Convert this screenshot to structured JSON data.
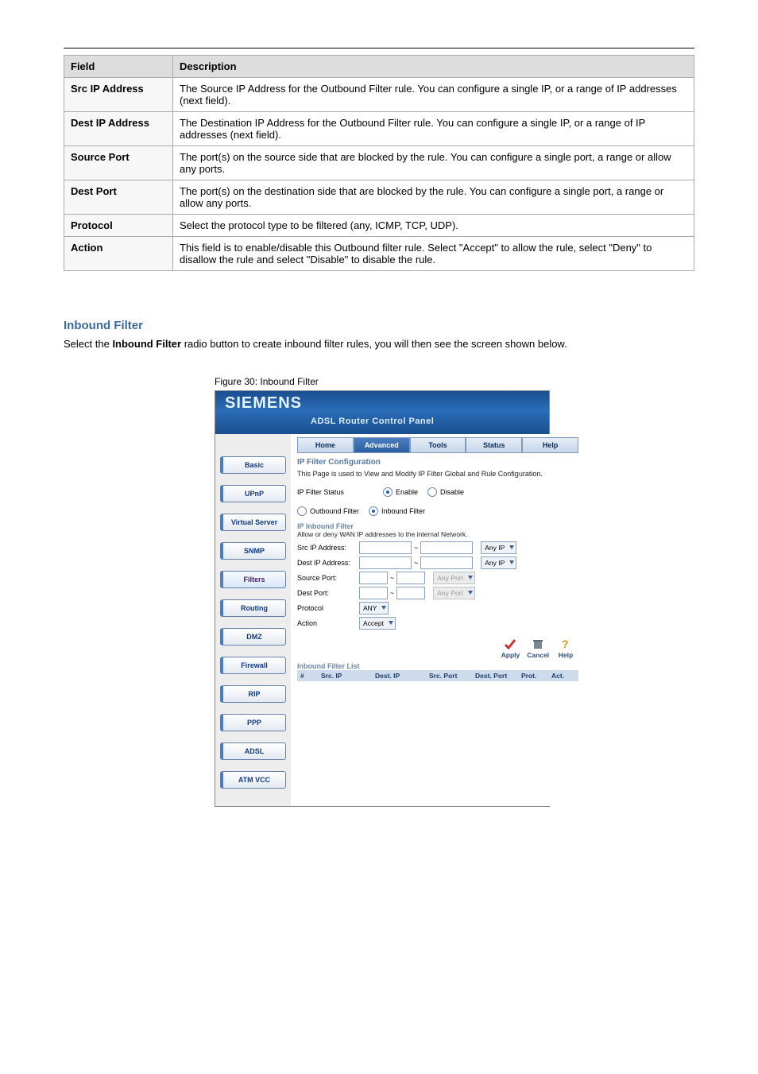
{
  "fields_table": {
    "headers": [
      "Field",
      "Description"
    ],
    "rows": [
      {
        "field": "Src IP Address",
        "desc": "The Source IP Address for the Outbound Filter rule. You can configure a single IP, or a range of IP addresses (next field)."
      },
      {
        "field": "Dest IP Address",
        "desc": "The Destination IP Address for the Outbound Filter rule. You can configure a single IP, or a range of IP addresses (next field)."
      },
      {
        "field": "Source Port",
        "desc": "The port(s) on the source side that are blocked by the rule. You can configure a single port, a range or allow any ports."
      },
      {
        "field": "Dest Port",
        "desc": "The port(s) on the destination side that are blocked by the rule. You can configure a single port, a range or allow any ports."
      },
      {
        "field": "Protocol",
        "desc": "Select the protocol type to be filtered (any, ICMP, TCP, UDP)."
      },
      {
        "field": "Action",
        "desc": "This field is to enable/disable this Outbound filter rule. Select \"Accept\" to allow the rule, select \"Deny\" to disallow the rule and select \"Disable\" to disable the rule."
      }
    ]
  },
  "section": {
    "heading": "Inbound Filter",
    "body_before": "Select the ",
    "body_bold": "Inbound Filter",
    "body_after": " radio button to create inbound filter rules, you will then see the screen shown below.",
    "caption": "Figure 30: Inbound Filter"
  },
  "ui": {
    "brand": "SIEMENS",
    "subtitle": "ADSL Router Control Panel",
    "sidebar": [
      "Basic",
      "UPnP",
      "Virtual Server",
      "SNMP",
      "Filters",
      "Routing",
      "DMZ",
      "Firewall",
      "RIP",
      "PPP",
      "ADSL",
      "ATM VCC"
    ],
    "sidebar_active_index": 4,
    "tabs": [
      "Home",
      "Advanced",
      "Tools",
      "Status",
      "Help"
    ],
    "tab_active_index": 1,
    "page_title": "IP Filter Configuration",
    "page_desc": "This Page is used to View and Modify IP Filter Global and Rule Configuration.",
    "status_label": "IP Filter Status",
    "status_enable": "Enable",
    "status_disable": "Disable",
    "dir_out": "Outbound Filter",
    "dir_in": "Inbound Filter",
    "inbound_title": "IP Inbound Filter",
    "inbound_note": "Allow or deny WAN IP addresses to the internal Network.",
    "rows": {
      "src_ip": "Src IP Address:",
      "dest_ip": "Dest IP Address:",
      "src_port": "Source Port:",
      "dest_port": "Dest Port:",
      "protocol": "Protocol",
      "action": "Action"
    },
    "sel_any_ip": "Any IP",
    "sel_any_port": "Any Port",
    "sel_protocol": "ANY",
    "sel_action": "Accept",
    "actions": {
      "apply": "Apply",
      "cancel": "Cancel",
      "help": "Help"
    },
    "list_heading": "Inbound Filter List",
    "list_cols": [
      "#",
      "Src. IP",
      "Dest. IP",
      "Src. Port",
      "Dest. Port",
      "Prot.",
      "Act."
    ]
  }
}
